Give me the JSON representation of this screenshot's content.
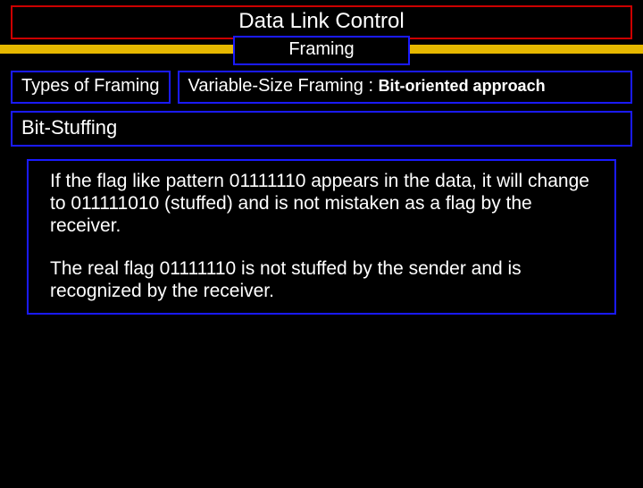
{
  "title": "Data Link Control",
  "framing": "Framing",
  "types_label": "Types of  Framing",
  "variable_prefix": "Variable-Size Framing : ",
  "variable_bold": "Bit-oriented approach",
  "bitstuff": "Bit-Stuffing",
  "para1": "If the flag like pattern 01111110 appears in the data, it will change to 011111010 (stuffed) and is not mistaken as a flag by the receiver.",
  "para2": "The real flag 01111110 is not stuffed by the sender and is recognized by the receiver."
}
